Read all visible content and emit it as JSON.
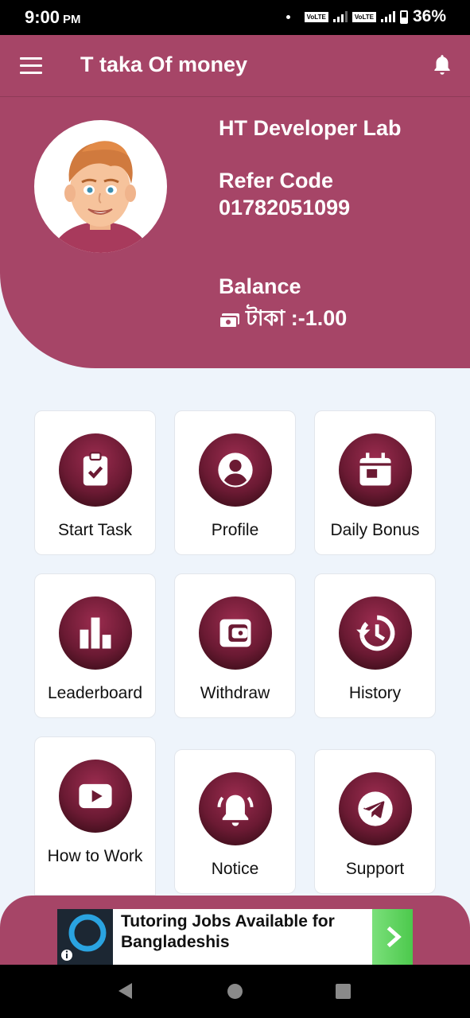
{
  "status_bar": {
    "time": "9:00",
    "ampm": "PM",
    "network1": "VoLTE",
    "network2": "VoLTE",
    "battery": "36%"
  },
  "app_bar": {
    "title": "T taka Of money"
  },
  "header": {
    "name": "HT Developer Lab",
    "refer_label": "Refer Code",
    "refer_code": "01782051099",
    "balance_label": "Balance",
    "balance_value": "টাকা :-1.00"
  },
  "menu": [
    {
      "label": "Start Task",
      "icon": "clipboard-check-icon"
    },
    {
      "label": "Profile",
      "icon": "user-circle-icon"
    },
    {
      "label": "Daily Bonus",
      "icon": "calendar-icon"
    },
    {
      "label": "Leaderboard",
      "icon": "bar-chart-icon"
    },
    {
      "label": "Withdraw",
      "icon": "wallet-icon"
    },
    {
      "label": "History",
      "icon": "history-icon"
    },
    {
      "label": "How to Work",
      "icon": "play-icon"
    },
    {
      "label": "Notice",
      "icon": "bell-ring-icon"
    },
    {
      "label": "Support",
      "icon": "telegram-icon"
    }
  ],
  "ad": {
    "text": "Tutoring Jobs Available for Bangladeshis"
  },
  "colors": {
    "primary": "#a64567",
    "icon_dark": "#6b1a33",
    "background": "#eef4fb"
  }
}
